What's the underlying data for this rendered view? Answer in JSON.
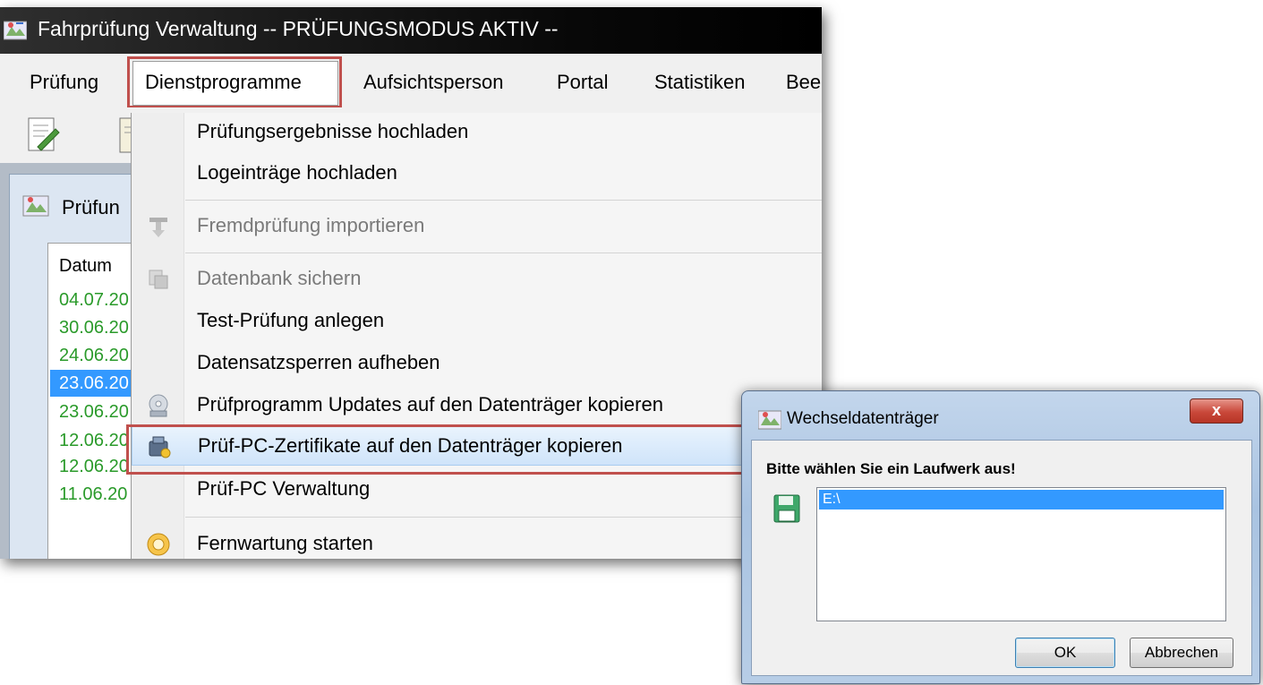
{
  "window": {
    "title": "Fahrprüfung Verwaltung -- PRÜFUNGSMODUS AKTIV --"
  },
  "menubar": {
    "items": [
      {
        "label": "Prüfung"
      },
      {
        "label": "Dienstprogramme"
      },
      {
        "label": "Aufsichtsperson"
      },
      {
        "label": "Portal"
      },
      {
        "label": "Statistiken"
      },
      {
        "label": "Bee"
      }
    ],
    "open_item": "Dienstprogramme"
  },
  "child_window": {
    "title": "Prüfun",
    "grid": {
      "column_header": "Datum",
      "rows": [
        "04.07.20",
        "30.06.20",
        "24.06.20",
        "23.06.20",
        "23.06.20",
        "12.06.20",
        "12.06.20",
        "11.06.20"
      ],
      "selected_index": 3
    }
  },
  "dropdown": {
    "items": [
      {
        "label": "Prüfungsergebnisse hochladen",
        "enabled": true,
        "icon": ""
      },
      {
        "label": "Logeinträge hochladen",
        "enabled": true,
        "icon": ""
      },
      {
        "label": "Fremdprüfung importieren",
        "enabled": false,
        "icon": "import-icon"
      },
      {
        "label": "Datenbank sichern",
        "enabled": false,
        "icon": "database-backup-icon"
      },
      {
        "label": "Test-Prüfung anlegen",
        "enabled": true,
        "icon": ""
      },
      {
        "label": "Datensatzsperren aufheben",
        "enabled": true,
        "icon": ""
      },
      {
        "label": "Prüfprogramm Updates auf den Datenträger kopieren",
        "enabled": true,
        "icon": "disc-icon"
      },
      {
        "label": "Prüf-PC-Zertifikate auf den Datenträger kopieren",
        "enabled": true,
        "icon": "certificate-icon"
      },
      {
        "label": "Prüf-PC Verwaltung",
        "enabled": true,
        "icon": ""
      },
      {
        "label": "Fernwartung starten",
        "enabled": true,
        "icon": "remote-support-icon"
      }
    ],
    "highlighted_index": 7
  },
  "dialog": {
    "title": "Wechseldatenträger",
    "close_label": "x",
    "prompt": "Bitte wählen Sie ein Laufwerk aus!",
    "drives": [
      "E:\\"
    ],
    "selected_drive": "E:\\",
    "ok_label": "OK",
    "cancel_label": "Abbrechen"
  },
  "colors": {
    "highlight_frame": "#c0504d",
    "selection": "#3399ff",
    "grid_text": "#2a9a2a"
  }
}
